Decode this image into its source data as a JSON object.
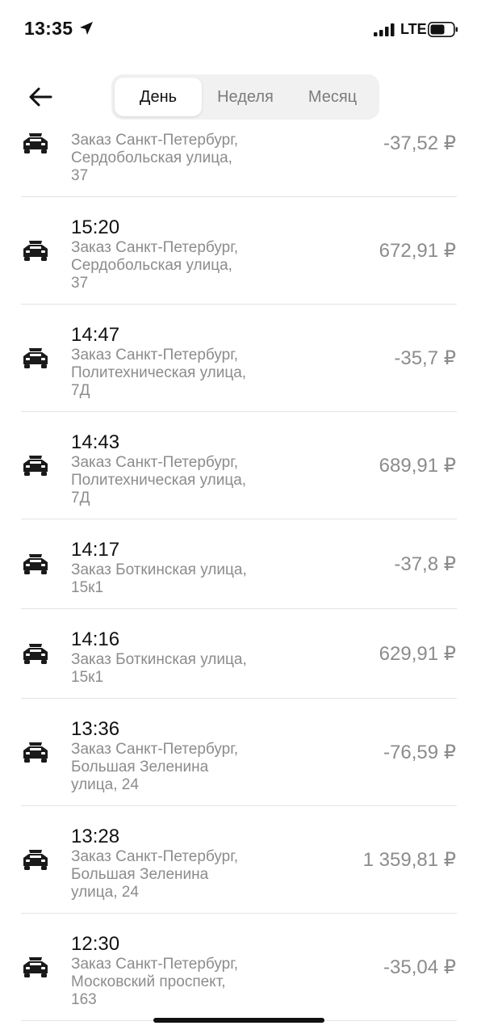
{
  "status": {
    "time": "13:35",
    "network": "LTE",
    "icons": [
      "location-arrow-icon",
      "signal-icon",
      "battery-icon"
    ]
  },
  "header": {
    "back_icon": "arrow-left-icon",
    "tabs": [
      {
        "label": "День",
        "active": true
      },
      {
        "label": "Неделя",
        "active": false
      },
      {
        "label": "Месяц",
        "active": false
      }
    ]
  },
  "transactions": [
    {
      "time": "",
      "desc_lines": [
        "Заказ Санкт-Петербург,",
        "Сердобольская улица,",
        "37"
      ],
      "amount": "-37,52 ₽",
      "icon": "taxi-car-icon"
    },
    {
      "time": "15:20",
      "desc_lines": [
        "Заказ Санкт-Петербург,",
        "Сердобольская улица,",
        "37"
      ],
      "amount": "672,91 ₽",
      "icon": "taxi-car-icon"
    },
    {
      "time": "14:47",
      "desc_lines": [
        "Заказ Санкт-Петербург,",
        "Политехническая улица,",
        "7Д"
      ],
      "amount": "-35,7 ₽",
      "icon": "taxi-car-icon"
    },
    {
      "time": "14:43",
      "desc_lines": [
        "Заказ Санкт-Петербург,",
        "Политехническая улица,",
        "7Д"
      ],
      "amount": "689,91 ₽",
      "icon": "taxi-car-icon"
    },
    {
      "time": "14:17",
      "desc_lines": [
        "Заказ Боткинская улица,",
        "15к1"
      ],
      "amount": "-37,8 ₽",
      "icon": "taxi-car-icon"
    },
    {
      "time": "14:16",
      "desc_lines": [
        "Заказ Боткинская улица,",
        "15к1"
      ],
      "amount": "629,91 ₽",
      "icon": "taxi-car-icon"
    },
    {
      "time": "13:36",
      "desc_lines": [
        "Заказ Санкт-Петербург,",
        "Большая Зеленина",
        "улица, 24"
      ],
      "amount": "-76,59 ₽",
      "icon": "taxi-car-icon"
    },
    {
      "time": "13:28",
      "desc_lines": [
        "Заказ Санкт-Петербург,",
        "Большая Зеленина",
        "улица, 24"
      ],
      "amount": "1 359,81 ₽",
      "icon": "taxi-car-icon"
    },
    {
      "time": "12:30",
      "desc_lines": [
        "Заказ Санкт-Петербург,",
        "Московский проспект,",
        "163"
      ],
      "amount": "-35,04 ₽",
      "icon": "taxi-car-icon"
    }
  ]
}
